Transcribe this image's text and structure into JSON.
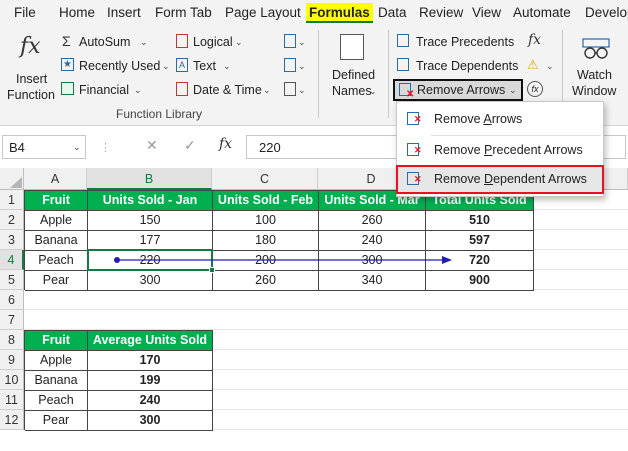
{
  "menu": {
    "tabs": [
      {
        "label": "File",
        "active": false
      },
      {
        "label": "Home",
        "active": false
      },
      {
        "label": "Insert",
        "active": false
      },
      {
        "label": "Form Tab",
        "active": false
      },
      {
        "label": "Page Layout",
        "active": false
      },
      {
        "label": "Formulas",
        "active": true
      },
      {
        "label": "Data",
        "active": false
      },
      {
        "label": "Review",
        "active": false
      },
      {
        "label": "View",
        "active": false
      },
      {
        "label": "Automate",
        "active": false
      },
      {
        "label": "Develop",
        "active": false
      }
    ]
  },
  "ribbon": {
    "insert_function": {
      "line1": "Insert",
      "line2": "Function",
      "icon": "fx-icon"
    },
    "autosum": "AutoSum",
    "recently_used": "Recently Used",
    "financial": "Financial",
    "logical": "Logical",
    "text": "Text",
    "date_time": "Date & Time",
    "function_library_label": "Function Library",
    "defined_names": {
      "line1": "Defined",
      "line2": "Names"
    },
    "trace_precedents": "Trace Precedents",
    "trace_dependents": "Trace Dependents",
    "remove_arrows": "Remove Arrows",
    "watch_window": {
      "line1": "Watch",
      "line2": "Window"
    }
  },
  "dropdown": {
    "items": [
      {
        "before": "Remove ",
        "u": "A",
        "after": "rrows"
      },
      {
        "before": "Remove ",
        "u": "P",
        "after": "recedent Arrows"
      },
      {
        "before": "Remove ",
        "u": "D",
        "after": "ependent Arrows"
      }
    ],
    "highlight_color": "#e81123"
  },
  "formula_bar": {
    "name_box": "B4",
    "fx_label": "fx",
    "formula": "220"
  },
  "sheet": {
    "columns": [
      "A",
      "B",
      "C",
      "D",
      "E"
    ],
    "rows": [
      "1",
      "2",
      "3",
      "4",
      "5",
      "6",
      "7",
      "8",
      "9",
      "10",
      "11",
      "12"
    ],
    "selected_cell": "B4",
    "header_color": "#00b050",
    "table1": {
      "headers": [
        "Fruit",
        "Units Sold - Jan",
        "Units Sold - Feb",
        "Units Sold - Mar",
        "Total Units Sold"
      ],
      "rows": [
        [
          "Apple",
          "150",
          "100",
          "260",
          "510"
        ],
        [
          "Banana",
          "177",
          "180",
          "240",
          "597"
        ],
        [
          "Peach",
          "220",
          "200",
          "300",
          "720"
        ],
        [
          "Pear",
          "300",
          "260",
          "340",
          "900"
        ]
      ]
    },
    "table2": {
      "headers": [
        "Fruit",
        "Average Units Sold"
      ],
      "rows": [
        [
          "Apple",
          "170"
        ],
        [
          "Banana",
          "199"
        ],
        [
          "Peach",
          "240"
        ],
        [
          "Pear",
          "300"
        ]
      ]
    }
  }
}
